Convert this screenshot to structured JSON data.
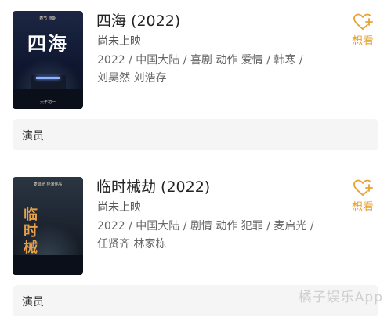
{
  "movies": [
    {
      "title": "四海 (2022)",
      "status": "尚未上映",
      "meta": "2022 / 中国大陆 / 喜剧 动作 爱情 / 韩寒 / 刘昊然 刘浩存",
      "want_label": "想看",
      "actors_label": "演员",
      "poster": {
        "title": "四海",
        "top_text": "春节 档期",
        "bottom_text": "大年初一"
      }
    },
    {
      "title": "临时械劫 (2022)",
      "status": "尚未上映",
      "meta": "2022 / 中国大陆 / 剧情 动作 犯罪 / 麦启光 / 任贤齐 林家栋",
      "want_label": "想看",
      "actors_label": "演员",
      "poster": {
        "title": "临时械劫",
        "top_text": "麦启光 导演作品",
        "bottom_text": ""
      }
    }
  ],
  "watermark": "橘子娱乐App",
  "colors": {
    "accent": "#e8a22c",
    "title": "#222222",
    "meta": "#666666",
    "actors_bar_bg": "#f5f5f5"
  }
}
